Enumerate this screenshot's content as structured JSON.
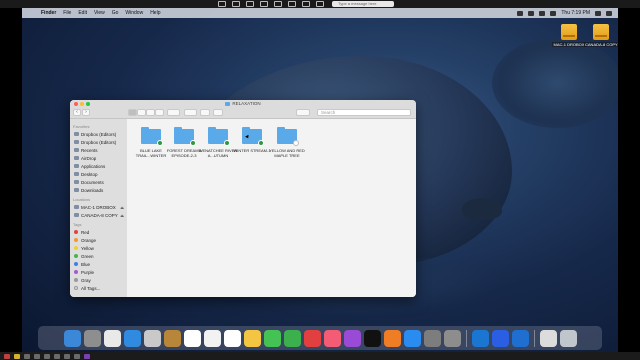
{
  "share_bar": {
    "search_placeholder": "Type a message here"
  },
  "menubar": {
    "app": "Finder",
    "items": [
      "File",
      "Edit",
      "View",
      "Go",
      "Window",
      "Help"
    ],
    "clock": "Thu 7:19 PM"
  },
  "desktop": {
    "drives": [
      "MAC-1 DROBOX",
      "CANADA-8 COPY"
    ]
  },
  "finder": {
    "title": "RELAXATION",
    "search_placeholder": "Search",
    "sidebar": {
      "favorites_heading": "Favorites",
      "favorites": [
        "Dropbox (Editors)",
        "Dropbox (Editors)",
        "Recents",
        "AirDrop",
        "Applications",
        "Desktop",
        "Documents",
        "Downloads"
      ],
      "locations_heading": "Locations",
      "locations": [
        "MAC-1 DROBOX",
        "CANADA-8 COPY"
      ],
      "eject_glyph": "⏏",
      "tags_heading": "Tags",
      "tags": [
        {
          "label": "Red",
          "color": "#e0453a"
        },
        {
          "label": "Orange",
          "color": "#f29a2e"
        },
        {
          "label": "Yellow",
          "color": "#f2cf2e"
        },
        {
          "label": "Green",
          "color": "#45b649"
        },
        {
          "label": "Blue",
          "color": "#3d83e6"
        },
        {
          "label": "Purple",
          "color": "#a55bcc"
        },
        {
          "label": "Gray",
          "color": "#9a9a9a"
        },
        {
          "label": "All Tags...",
          "color": ""
        }
      ]
    },
    "folders": [
      {
        "name": "BLUE LAKE TRAIL...WINTER"
      },
      {
        "name": "FOREST DREAMS EPISODE-2-3"
      },
      {
        "name": "WENATCHEE RIVER A...UTUMN"
      },
      {
        "name": "WINTER STREAM-1"
      },
      {
        "name": "YELLOW AND RED MAPLE TREE"
      }
    ]
  },
  "dock": {
    "icons": [
      "finder-icon",
      "launchpad-icon",
      "chrome-icon",
      "safari-icon",
      "preview-icon",
      "notes-book-icon",
      "calendar-icon",
      "textedit-icon",
      "reminders-icon",
      "photos-icon",
      "messages-icon",
      "facetime-icon",
      "news-icon",
      "music-icon",
      "podcasts-icon",
      "apple-tv-icon",
      "books-icon",
      "app-store-icon",
      "system-preferences-icon",
      "screenshot-icon",
      "teamviewer-icon",
      "dropbox-icon",
      "edge-icon",
      "documents-icon",
      "trash-icon"
    ],
    "colors": [
      "#3b87d8",
      "#8e8e8e",
      "#e9e9e9",
      "#2f8ae0",
      "#c9c9c9",
      "#b8863a",
      "#ffffff",
      "#f2f2f2",
      "#ffffff",
      "#f4c542",
      "#45c254",
      "#3bb04c",
      "#e24040",
      "#f45c76",
      "#9a4bd6",
      "#111111",
      "#ef7d25",
      "#2b8cf0",
      "#7d7d7d",
      "#8d8d8d",
      "#1b76d2",
      "#2b5fe3",
      "#1e6fd0",
      "#dcdcdc",
      "#bfc6cc"
    ]
  }
}
